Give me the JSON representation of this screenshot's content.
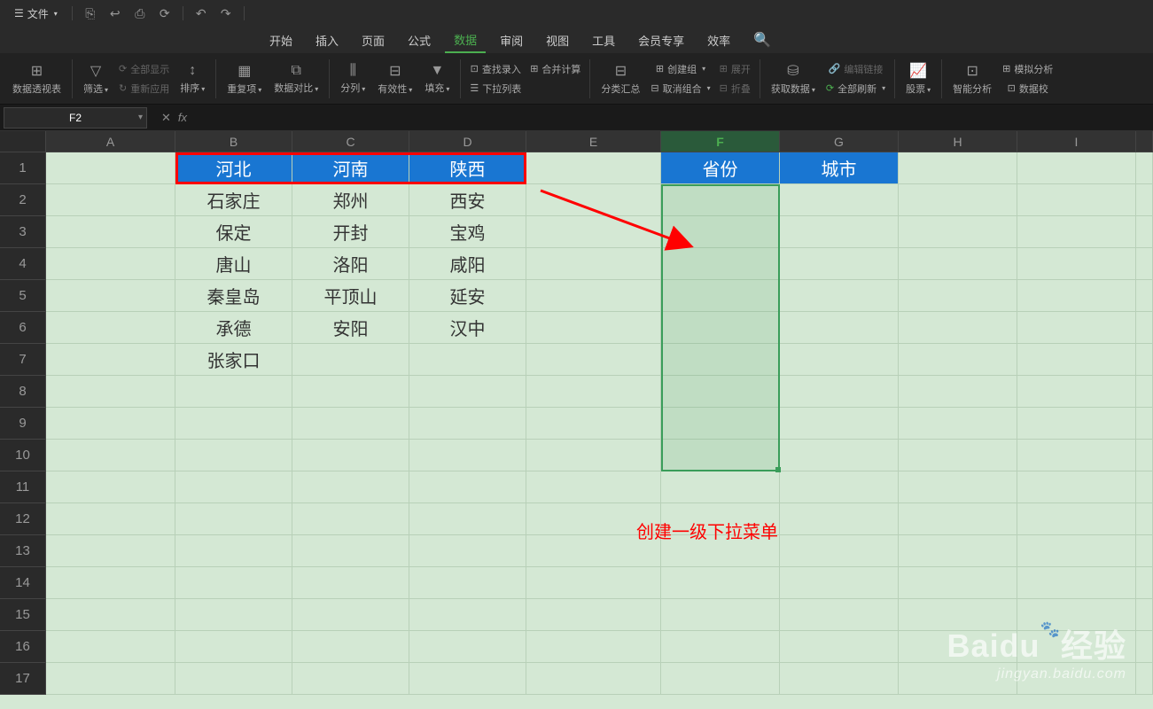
{
  "titleBar": {
    "fileMenu": "文件",
    "qat": [
      "⎘",
      "↩",
      "⎙",
      "⟳",
      "↶",
      "↷"
    ]
  },
  "menu": {
    "items": [
      "开始",
      "插入",
      "页面",
      "公式",
      "数据",
      "审阅",
      "视图",
      "工具",
      "会员专享",
      "效率"
    ],
    "activeIndex": 4
  },
  "ribbon": {
    "pivot": "数据透视表",
    "filter": "筛选",
    "showAll": "全部显示",
    "reapply": "重新应用",
    "sort": "排序",
    "dup": "重复项",
    "compare": "数据对比",
    "split": "分列",
    "validate": "有效性",
    "fill": "填充",
    "lookup": "查找录入",
    "consol": "合并计算",
    "dropdown": "下拉列表",
    "subtotal": "分类汇总",
    "group": "创建组",
    "ungroup": "取消组合",
    "expand": "展开",
    "collapse": "折叠",
    "getdata": "获取数据",
    "refresh": "全部刷新",
    "editlink": "编辑链接",
    "stocks": "股票",
    "analysis": "智能分析",
    "whatif": "模拟分析",
    "check": "数据校"
  },
  "formulaBar": {
    "nameBox": "F2",
    "fx": "fx"
  },
  "columns": [
    "A",
    "B",
    "C",
    "D",
    "E",
    "F",
    "G",
    "H",
    "I",
    ""
  ],
  "selectedCol": "F",
  "rows": [
    1,
    2,
    3,
    4,
    5,
    6,
    7,
    8,
    9,
    10,
    11,
    12,
    13,
    14,
    15,
    16,
    17
  ],
  "cells": {
    "B1": "河北",
    "C1": "河南",
    "D1": "陕西",
    "F1": "省份",
    "G1": "城市",
    "B2": "石家庄",
    "C2": "郑州",
    "D2": "西安",
    "B3": "保定",
    "C3": "开封",
    "D3": "宝鸡",
    "B4": "唐山",
    "C4": "洛阳",
    "D4": "咸阳",
    "B5": "秦皇岛",
    "C5": "平顶山",
    "D5": "延安",
    "B6": "承德",
    "C6": "安阳",
    "D6": "汉中",
    "B7": "张家口"
  },
  "annotation": "创建一级下拉菜单",
  "watermark": {
    "main": "Baidu",
    "exp": "经验",
    "sub": "jingyan.baidu.com"
  }
}
